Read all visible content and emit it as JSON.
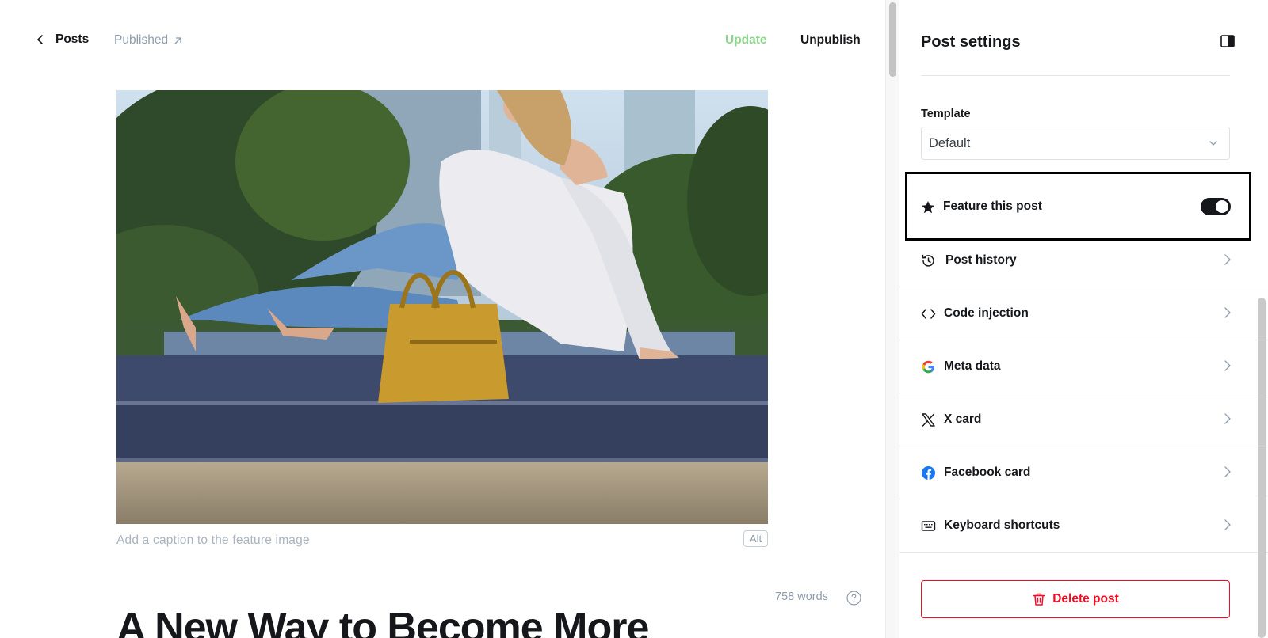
{
  "editor": {
    "back_label": "Posts",
    "status_label": "Published",
    "update_label": "Update",
    "unpublish_label": "Unpublish",
    "caption_placeholder": "Add a caption to the feature image",
    "alt_label": "Alt",
    "word_count": "758 words",
    "title": "A New Way to Become More"
  },
  "settings": {
    "title": "Post settings",
    "template_label": "Template",
    "template_value": "Default",
    "feature_label": "Feature this post",
    "feature_enabled": true,
    "items": [
      {
        "label": "Post history",
        "icon": "history-icon"
      },
      {
        "label": "Code injection",
        "icon": "code-icon"
      },
      {
        "label": "Meta data",
        "icon": "google-icon"
      },
      {
        "label": "X card",
        "icon": "x-icon"
      },
      {
        "label": "Facebook card",
        "icon": "facebook-icon"
      },
      {
        "label": "Keyboard shortcuts",
        "icon": "keyboard-icon"
      }
    ],
    "delete_label": "Delete post"
  },
  "colors": {
    "update_green": "#8ed68e",
    "delete_red": "#f50b23",
    "text_dark": "#15171a",
    "muted": "#8e9cac"
  }
}
